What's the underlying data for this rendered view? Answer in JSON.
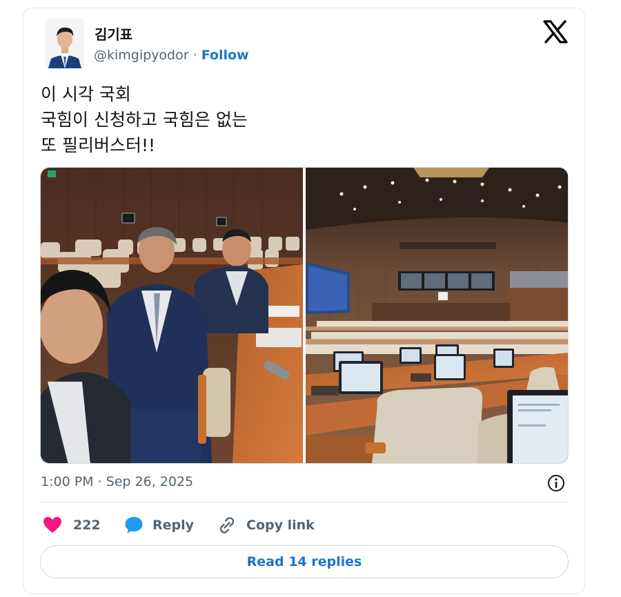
{
  "author": {
    "name": "김기표",
    "handle": "@kimgipyodor",
    "separator": " · ",
    "follow_label": "Follow"
  },
  "tweet": {
    "lines": [
      "이 시각 국회",
      "국힘이 신청하고 국힘은 없는",
      "또 필리버스터!!"
    ]
  },
  "meta": {
    "timestamp": "1:00 PM · Sep 26, 2025"
  },
  "actions": {
    "like_count": "222",
    "reply_label": "Reply",
    "copy_label": "Copy link"
  },
  "footer": {
    "read_replies_label": "Read 14 replies"
  },
  "colors": {
    "link": "#1d74c8",
    "heart": "#f91880",
    "reply_bubble": "#1d9bf0",
    "muted": "#536471"
  },
  "icons": {
    "brand": "x-logo-icon",
    "info": "info-icon",
    "like": "heart-icon",
    "reply": "speech-bubble-icon",
    "copy": "link-icon"
  }
}
